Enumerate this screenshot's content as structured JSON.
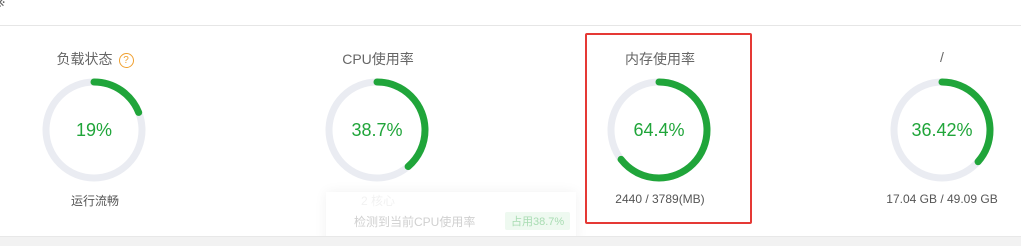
{
  "topbar": {
    "glyph": "※"
  },
  "panels": [
    {
      "title": "负载状态",
      "has_help": true,
      "help_symbol": "?",
      "value_text": "19%",
      "percent": 19,
      "footer": "运行流畅"
    },
    {
      "title": "CPU使用率",
      "value_text": "38.7%",
      "percent": 38.7,
      "footer": "2 核心"
    },
    {
      "title": "内存使用率",
      "value_text": "64.4%",
      "percent": 64.4,
      "footer": "2440 / 3789(MB)",
      "highlighted": true
    },
    {
      "title": "/",
      "value_text": "36.42%",
      "percent": 36.42,
      "footer": "17.04 GB / 49.09 GB"
    }
  ],
  "tooltip": {
    "text": "检测到当前CPU使用率",
    "badge": "占用38.7%"
  },
  "colors": {
    "gauge_fill": "#20a53a",
    "gauge_track": "#eaecf2",
    "highlight": "#e53935",
    "help": "#f0a030"
  }
}
